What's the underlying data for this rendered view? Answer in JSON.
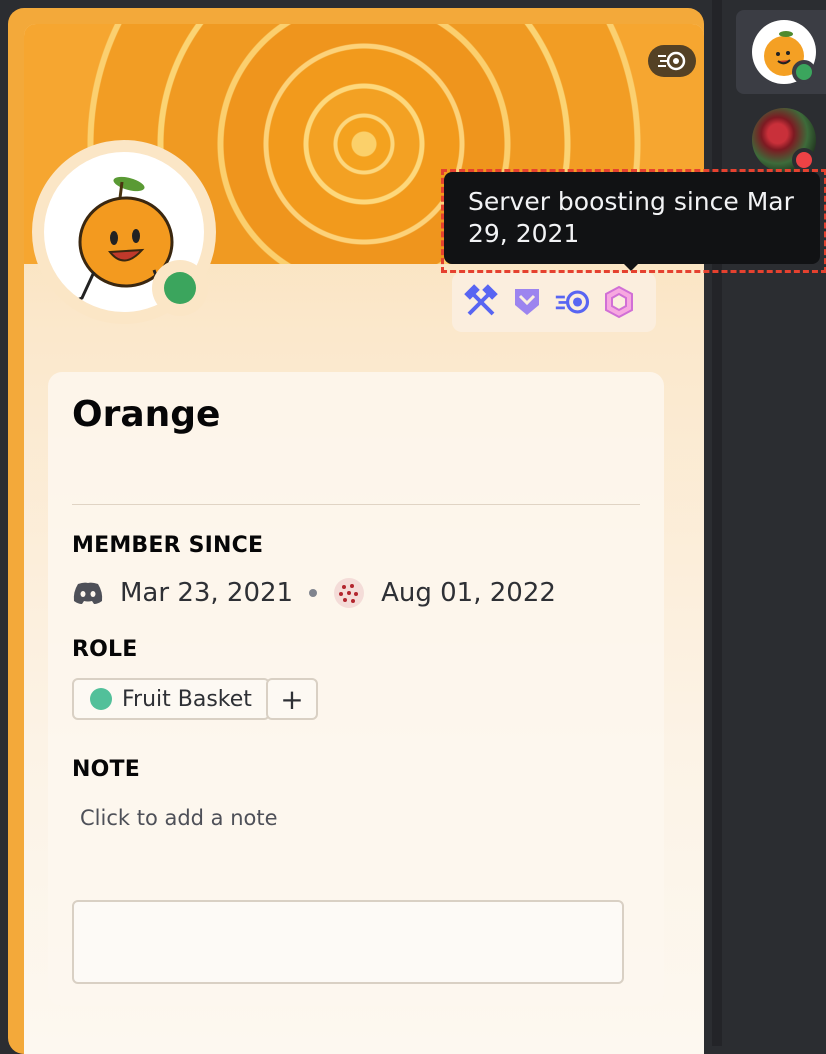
{
  "profile": {
    "username": "Orange",
    "status": "online",
    "tooltip": "Server boosting since Mar 29, 2021",
    "badges": [
      "hammer-badge-icon",
      "hypesquad-badge-icon",
      "server-boost-badge-icon",
      "nitro-badge-icon"
    ]
  },
  "member_since": {
    "title": "MEMBER SINCE",
    "discord_date": "Mar 23, 2021",
    "server_date": "Aug 01, 2022"
  },
  "role": {
    "title": "ROLE",
    "name": "Fruit Basket",
    "color": "#52c09a",
    "add_label": "+"
  },
  "note": {
    "title": "NOTE",
    "placeholder": "Click to add a note"
  },
  "colors": {
    "accent": "#f3a93a",
    "online": "#3ba55d",
    "dnd": "#ed4245",
    "tooltip_bg": "#111214"
  }
}
